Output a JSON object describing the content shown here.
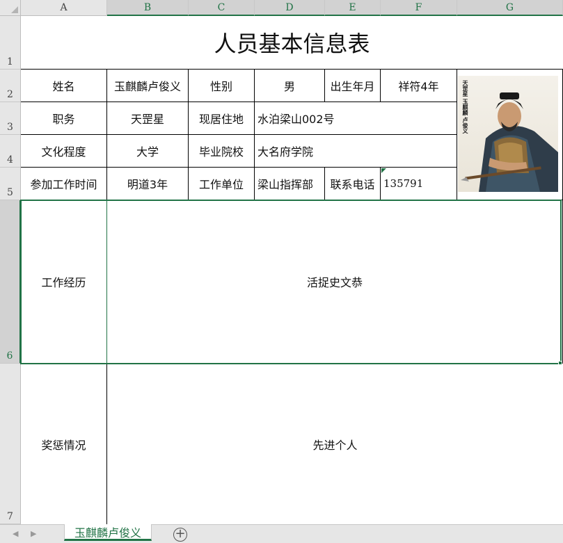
{
  "columns": [
    "A",
    "B",
    "C",
    "D",
    "E",
    "F",
    "G"
  ],
  "rows": [
    "1",
    "2",
    "3",
    "4",
    "5",
    "6",
    "7"
  ],
  "title": "人员基本信息表",
  "form": {
    "name_label": "姓名",
    "name_value": "玉麒麟卢俊义",
    "gender_label": "性别",
    "gender_value": "男",
    "birth_label": "出生年月",
    "birth_value": "祥符4年",
    "position_label": "职务",
    "position_value": "天罡星",
    "address_label": "现居住地",
    "address_value": "水泊梁山002号",
    "education_label": "文化程度",
    "education_value": "大学",
    "school_label": "毕业院校",
    "school_value": "大名府学院",
    "work_start_label": "参加工作时间",
    "work_start_value": "明道3年",
    "employer_label": "工作单位",
    "employer_value": "梁山指挥部",
    "phone_label": "联系电话",
    "phone_value": "135791",
    "experience_label": "工作经历",
    "experience_value": "活捉史文恭",
    "awards_label": "奖惩情况",
    "awards_value": "先进个人"
  },
  "photo": {
    "caption": "天罡星 玉麒麟 卢俊义",
    "description_icon": "portrait-image"
  },
  "sheet_tab": "玉麒麟卢俊义",
  "colors": {
    "accent": "#217346",
    "header_bg": "#e6e6e6",
    "grid_border": "#000000"
  }
}
